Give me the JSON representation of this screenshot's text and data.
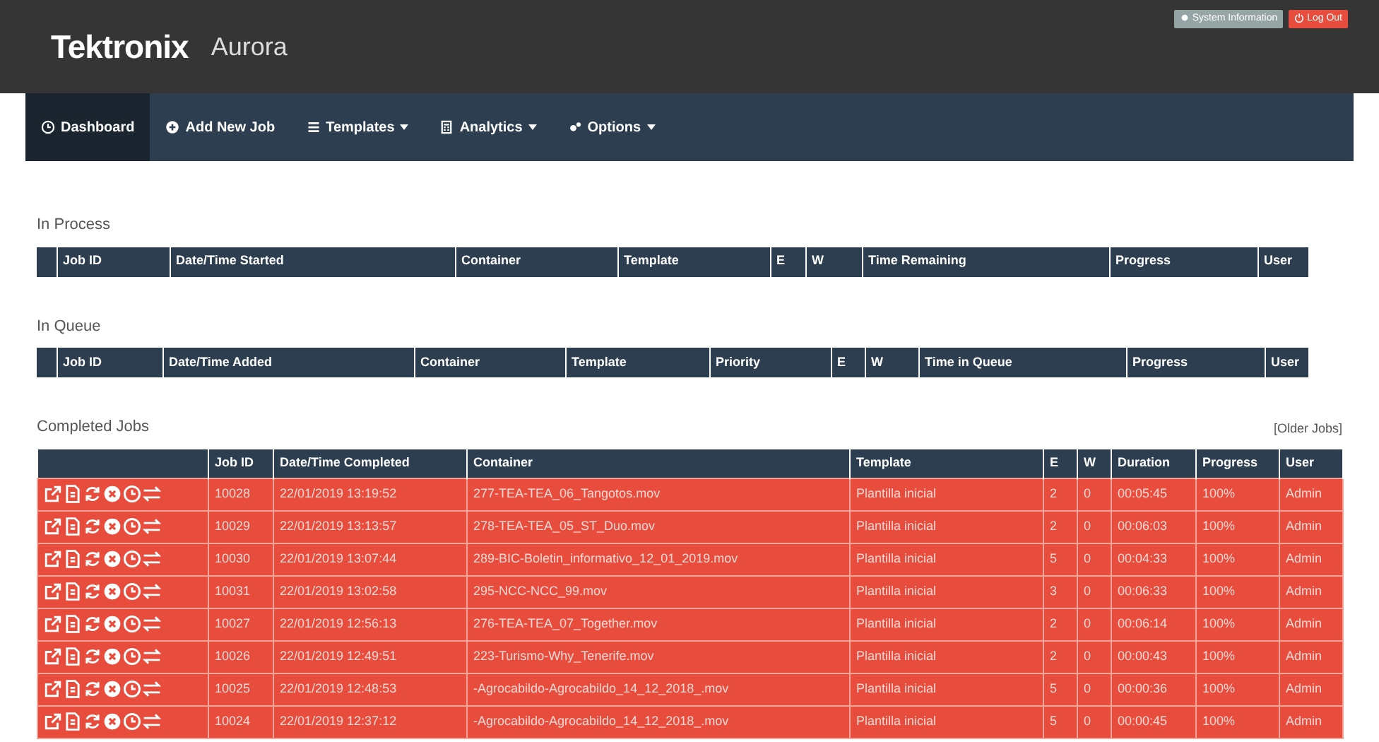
{
  "header": {
    "logo": "Tektronix",
    "product": "Aurora",
    "buttons": [
      {
        "label": "System Information",
        "kind": "info"
      },
      {
        "label": "Log Out",
        "kind": "logout"
      }
    ]
  },
  "nav": [
    {
      "label": "Dashboard",
      "kind": "clock",
      "selected": true,
      "dropdown": false
    },
    {
      "label": "Add New Job",
      "kind": "plus",
      "selected": false,
      "dropdown": false
    },
    {
      "label": "Templates",
      "kind": "list",
      "selected": false,
      "dropdown": true
    },
    {
      "label": "Analytics",
      "kind": "calc",
      "selected": false,
      "dropdown": true
    },
    {
      "label": "Options",
      "kind": "cogs",
      "selected": false,
      "dropdown": true
    }
  ],
  "in_process": {
    "title": "In Process",
    "columns": [
      "Job ID",
      "Date/Time Started",
      "Container",
      "Template",
      "E",
      "W",
      "Time Remaining",
      "Progress",
      "User"
    ]
  },
  "in_queue": {
    "title": "In Queue",
    "columns": [
      "Job ID",
      "Date/Time Added",
      "Container",
      "Template",
      "Priority",
      "E",
      "W",
      "Time in Queue",
      "Progress",
      "User"
    ]
  },
  "completed": {
    "title": "Completed Jobs",
    "link": "[Older Jobs]",
    "columns": [
      "Job ID",
      "Date/Time Completed",
      "Container",
      "Template",
      "E",
      "W",
      "Duration",
      "Progress",
      "User"
    ],
    "rows": [
      [
        "10028",
        "22/01/2019 13:19:52",
        "277-TEA-TEA_06_Tangotos.mov",
        "Plantilla inicial",
        "2",
        "0",
        "00:05:45",
        "100%",
        "Admin"
      ],
      [
        "10029",
        "22/01/2019 13:13:57",
        "278-TEA-TEA_05_ST_Duo.mov",
        "Plantilla inicial",
        "2",
        "0",
        "00:06:03",
        "100%",
        "Admin"
      ],
      [
        "10030",
        "22/01/2019 13:07:44",
        "289-BIC-Boletin_informativo_12_01_2019.mov",
        "Plantilla inicial",
        "5",
        "0",
        "00:04:33",
        "100%",
        "Admin"
      ],
      [
        "10031",
        "22/01/2019 13:02:58",
        "295-NCC-NCC_99.mov",
        "Plantilla inicial",
        "3",
        "0",
        "00:06:33",
        "100%",
        "Admin"
      ],
      [
        "10027",
        "22/01/2019 12:56:13",
        "276-TEA-TEA_07_Together.mov",
        "Plantilla inicial",
        "2",
        "0",
        "00:06:14",
        "100%",
        "Admin"
      ],
      [
        "10026",
        "22/01/2019 12:49:51",
        "223-Turismo-Why_Tenerife.mov",
        "Plantilla inicial",
        "2",
        "0",
        "00:00:43",
        "100%",
        "Admin"
      ],
      [
        "10025",
        "22/01/2019 12:48:53",
        "-Agrocabildo-Agrocabildo_14_12_2018_.mov",
        "Plantilla inicial",
        "5",
        "0",
        "00:00:36",
        "100%",
        "Admin"
      ],
      [
        "10024",
        "22/01/2019 12:37:12",
        "-Agrocabildo-Agrocabildo_14_12_2018_.mov",
        "Plantilla inicial",
        "5",
        "0",
        "00:00:45",
        "100%",
        "Admin"
      ]
    ]
  }
}
